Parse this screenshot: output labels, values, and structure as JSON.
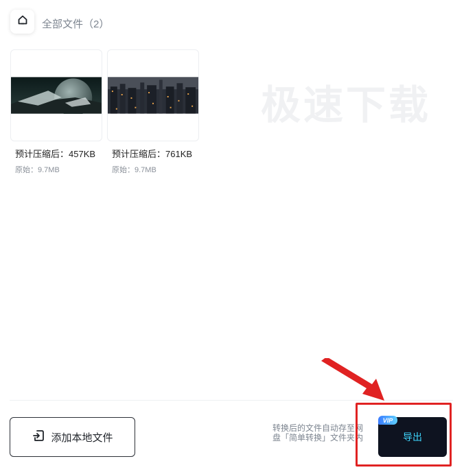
{
  "header": {
    "home_icon": "home-icon",
    "breadcrumb": "全部文件（2）"
  },
  "watermark": "极速下载",
  "files": [
    {
      "compressed": "预计压缩后：457KB",
      "original": "原始：9.7MB",
      "thumb": "planet-landscape"
    },
    {
      "compressed": "预计压缩后：761KB",
      "original": "原始：9.7MB",
      "thumb": "city-night"
    }
  ],
  "footer": {
    "add_label": "添加本地文件",
    "add_icon": "import-file-icon",
    "hint": "转换后的文件自动存至网盘「简单转换」文件夹内",
    "export_label": "导出",
    "vip_badge": "VIP"
  },
  "colors": {
    "annotation": "#e02222",
    "export_bg": "#0e1320",
    "export_text": "#3fd7ff"
  }
}
